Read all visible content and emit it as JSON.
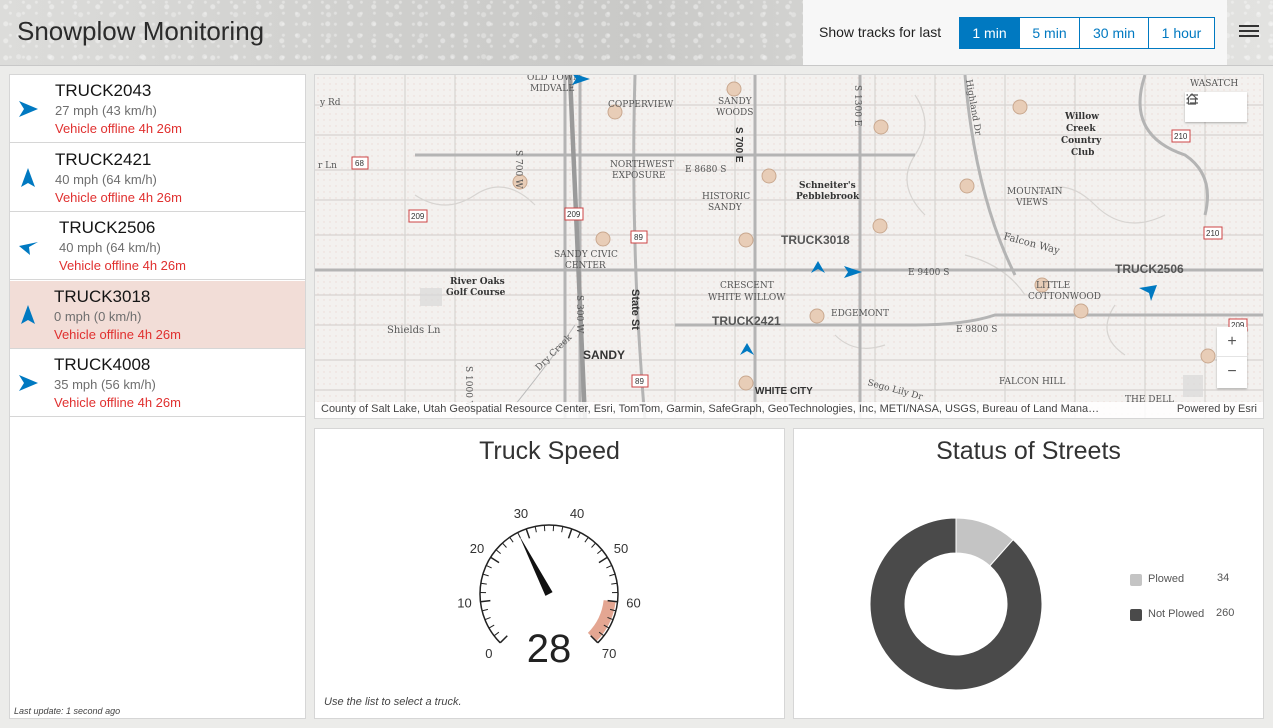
{
  "app": {
    "title": "Snowplow Monitoring"
  },
  "tracks": {
    "label": "Show tracks for last",
    "options": [
      "1 min",
      "5 min",
      "30 min",
      "1 hour"
    ],
    "selected": "1 min"
  },
  "trucks": [
    {
      "name": "TRUCK2043",
      "speed": "27 mph (43 km/h)",
      "status": "Vehicle offline 4h 26m",
      "heading": "east",
      "selected": false
    },
    {
      "name": "TRUCK2421",
      "speed": "40 mph (64 km/h)",
      "status": "Vehicle offline 4h 26m",
      "heading": "north",
      "selected": false
    },
    {
      "name": "TRUCK2506",
      "speed": "40 mph (64 km/h)",
      "status": "Vehicle offline 4h 26m",
      "heading": "west",
      "selected": false
    },
    {
      "name": "TRUCK3018",
      "speed": "0 mph (0 km/h)",
      "status": "Vehicle offline 4h 26m",
      "heading": "north",
      "selected": true
    },
    {
      "name": "TRUCK4008",
      "speed": "35 mph (56 km/h)",
      "status": "Vehicle offline 4h 26m",
      "heading": "east",
      "selected": false
    }
  ],
  "last_update": "Last update: 1 second ago",
  "map": {
    "attribution": "County of Salt Lake, Utah Geospatial Resource Center, Esri, TomTom, Garmin, SafeGraph, GeoTechnologies, Inc, METI/NASA, USGS, Bureau of Land Mana…",
    "powered_by": "Powered by Esri",
    "truck_labels": [
      "TRUCK3018",
      "TRUCK2421",
      "TRUCK2506"
    ],
    "place_labels": [
      "OLD TOWN MIDVALE",
      "COPPERVIEW",
      "SANDY WOODS",
      "NORTHWEST EXPOSURE",
      "HISTORIC SANDY",
      "Schneiter's Pebblebrook",
      "SANDY CIVIC CENTER",
      "River Oaks Golf Course",
      "CRESCENT WHITE WILLOW",
      "EDGEMONT",
      "SANDY",
      "WHITE CITY",
      "MOUNTAIN VIEWS",
      "LITTLE COTTONWOOD",
      "FALCON HILL",
      "Willow Creek Country Club",
      "WASATCH",
      "THE DELL"
    ],
    "road_labels": [
      "E 8680 S",
      "S 700 E",
      "S 1300 E",
      "E 9400 S",
      "E 9800 S",
      "Falcon Way",
      "State St",
      "Shields Ln",
      "Highland Dr",
      "S 1000 W",
      "S 300 W",
      "Dry Creek",
      "Sego Lily Dr",
      "S 700 W"
    ],
    "route_shields": [
      "68",
      "209",
      "209",
      "89",
      "89",
      "210",
      "210",
      "209"
    ],
    "controls": {
      "home": "home-icon",
      "layers": "list-icon",
      "zoom_in": "+",
      "zoom_out": "−"
    }
  },
  "speed_card": {
    "title": "Truck Speed",
    "value": 28,
    "min": 0,
    "max": 70,
    "ticks": [
      0,
      10,
      20,
      30,
      40,
      50,
      60,
      70
    ],
    "warning_range": [
      60,
      70
    ],
    "footnote": "Use the list to select a truck."
  },
  "status_card": {
    "title": "Status of Streets",
    "chart_data": {
      "type": "pie",
      "categories": [
        "Plowed",
        "Not Plowed"
      ],
      "values": [
        34,
        260
      ],
      "colors": [
        "#c4c4c4",
        "#4a4a4a"
      ]
    }
  }
}
